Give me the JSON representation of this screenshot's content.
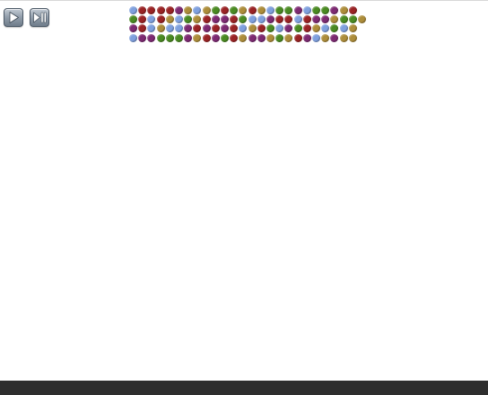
{
  "controls": {
    "play_icon": "play-icon",
    "step_icon": "play-pause-icon"
  },
  "palette": {
    "b": "#7fa0de",
    "r": "#9a2325",
    "p": "#7d2a72",
    "o": "#ad8d3a",
    "g": "#4a8a22"
  },
  "board": {
    "rows": [
      [
        "b",
        "r",
        "r",
        "r",
        "r",
        "p",
        "o",
        "b",
        "o",
        "g",
        "r",
        "g",
        "o",
        "r",
        "o",
        "b",
        "g",
        "g",
        "p",
        "b",
        "g",
        "g",
        "p",
        "o",
        "r"
      ],
      [
        "g",
        "r",
        "b",
        "r",
        "o",
        "b",
        "g",
        "o",
        "r",
        "p",
        "p",
        "r",
        "g",
        "b",
        "b",
        "p",
        "r",
        "r",
        "b",
        "r",
        "p",
        "p",
        "o",
        "g",
        "g",
        "o"
      ],
      [
        "p",
        "r",
        "b",
        "o",
        "b",
        "b",
        "p",
        "r",
        "p",
        "r",
        "p",
        "r",
        "b",
        "o",
        "r",
        "g",
        "b",
        "p",
        "g",
        "r",
        "o",
        "b",
        "g",
        "b",
        "o"
      ],
      [
        "b",
        "p",
        "p",
        "g",
        "g",
        "g",
        "p",
        "o",
        "r",
        "p",
        "g",
        "r",
        "o",
        "p",
        "p",
        "o",
        "g",
        "o",
        "r",
        "p",
        "b",
        "o",
        "p",
        "o",
        "o"
      ]
    ]
  }
}
